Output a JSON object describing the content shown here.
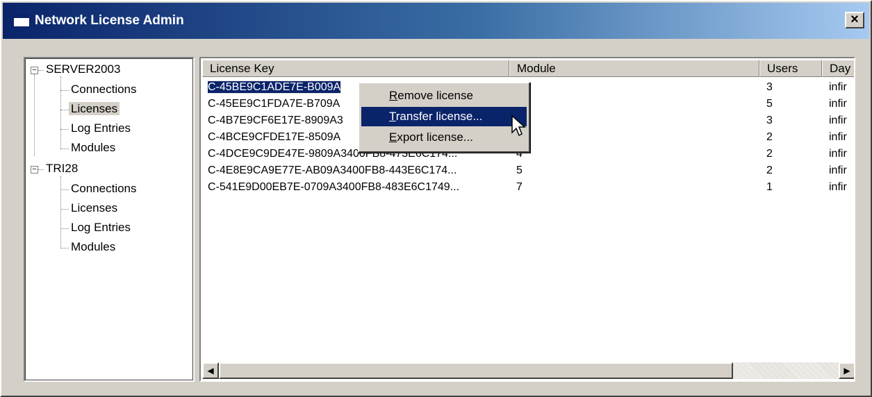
{
  "window": {
    "title": "Network License Admin",
    "close_label": "×"
  },
  "tree": {
    "collapse_glyph": "−",
    "servers": [
      {
        "name": "SERVER2003",
        "children": [
          "Connections",
          "Licenses",
          "Log Entries",
          "Modules"
        ],
        "selected_child": 1
      },
      {
        "name": "TRI28",
        "children": [
          "Connections",
          "Licenses",
          "Log Entries",
          "Modules"
        ]
      }
    ]
  },
  "table": {
    "columns": [
      "License Key",
      "Module",
      "Users",
      "Day"
    ],
    "rows": [
      {
        "key": "C-45BE9C1ADE7E-B009A",
        "module": "",
        "users": "3",
        "days": "infir",
        "selected": true
      },
      {
        "key": "C-45EE9C1FDA7E-B709A",
        "module": "",
        "users": "5",
        "days": "infir"
      },
      {
        "key": "C-4B7E9CF6E17E-8909A3",
        "module": "",
        "users": "3",
        "days": "infir"
      },
      {
        "key": "C-4BCE9CFDE17E-8509A",
        "module": "",
        "users": "2",
        "days": "infir"
      },
      {
        "key": "C-4DCE9C9DE47E-9809A3400FB8-473E6C174...",
        "module": "4",
        "users": "2",
        "days": "infir"
      },
      {
        "key": "C-4E8E9CA9E77E-AB09A3400FB8-443E6C174...",
        "module": "5",
        "users": "2",
        "days": "infir"
      },
      {
        "key": "C-541E9D00EB7E-0709A3400FB8-483E6C1749...",
        "module": "7",
        "users": "1",
        "days": "infir"
      }
    ]
  },
  "context_menu": {
    "items": [
      {
        "accel": "R",
        "rest": "emove license",
        "active": false
      },
      {
        "accel": "T",
        "rest": "ransfer license...",
        "active": true
      },
      {
        "accel": "E",
        "rest": "xport license...",
        "active": false
      }
    ]
  },
  "scrollbar": {
    "left_arrow": "◀",
    "right_arrow": "▶"
  },
  "colors": {
    "selection": "#0a246a",
    "face": "#d4d0c8"
  }
}
